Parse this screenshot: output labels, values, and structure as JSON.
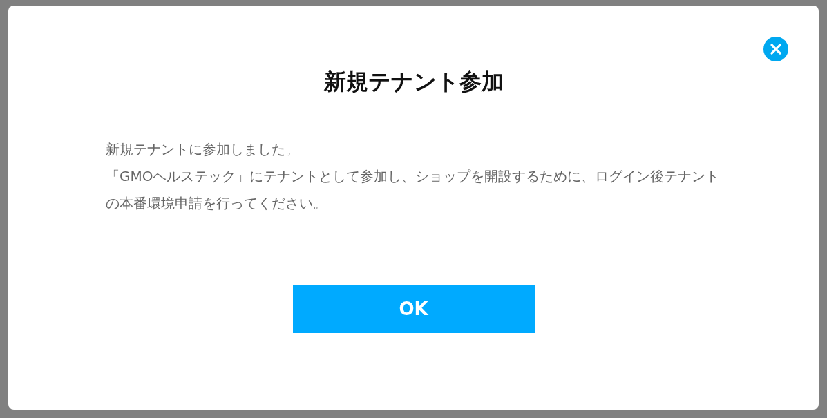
{
  "dialog": {
    "title": "新規テナント参加",
    "message": [
      "新規テナントに参加しました。",
      "「GMOヘルステック」にテナントとして参加し、ショップを開設するために、ログイン後テナントの本番環境申請を行ってください。"
    ],
    "button": "OK"
  }
}
